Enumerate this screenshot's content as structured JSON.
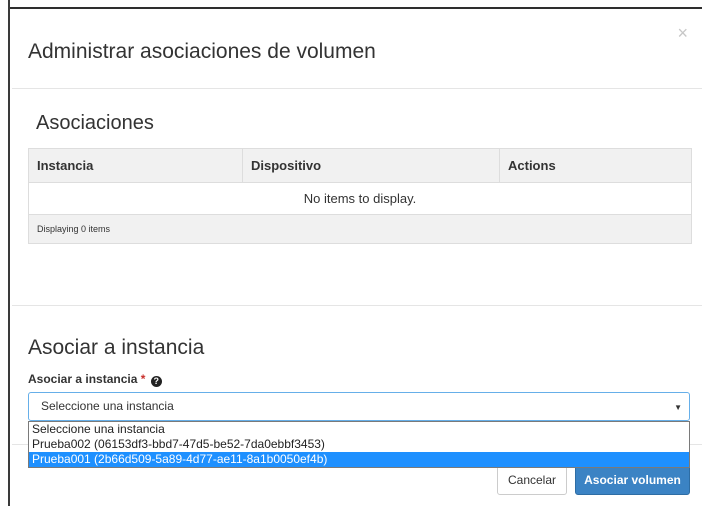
{
  "modal": {
    "title": "Administrar asociaciones de volumen",
    "close_glyph": "×"
  },
  "associations": {
    "heading": "Asociaciones",
    "columns": [
      "Instancia",
      "Dispositivo",
      "Actions"
    ],
    "empty_message": "No items to display.",
    "footer_text": "Displaying 0 items"
  },
  "attach": {
    "heading": "Asociar a instancia",
    "label": "Asociar a instancia",
    "required_mark": "*",
    "help_icon": "question-circle-icon",
    "help_glyph": "?",
    "select_value": "Seleccione una instancia",
    "select_arrow": "▼",
    "options": [
      "Seleccione una instancia",
      "Prueba002 (06153df3-bbd7-47d5-be52-7da0ebbf3453)",
      "Prueba001 (2b66d509-5a89-4d77-ae11-8a1b0050ef4b)"
    ],
    "highlighted_option_index": 2
  },
  "buttons": {
    "cancel": "Cancelar",
    "submit": "Asociar volumen"
  },
  "colors": {
    "primary": "#3b83c4",
    "highlight": "#1e90ff",
    "focus_border": "#66afe9"
  }
}
